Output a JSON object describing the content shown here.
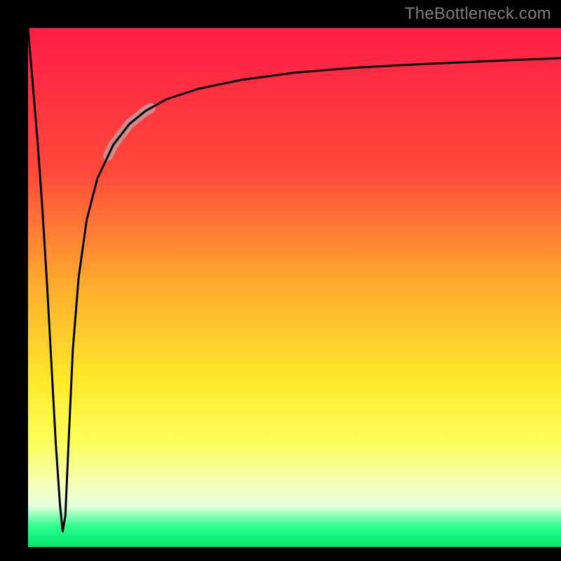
{
  "watermark": "TheBottleneck.com",
  "chart_data": {
    "type": "line",
    "title": "",
    "xlabel": "",
    "ylabel": "",
    "xlim": [
      0,
      100
    ],
    "ylim": [
      0,
      100
    ],
    "gradient_stops": [
      {
        "offset": 0,
        "color": "#ff1c46"
      },
      {
        "offset": 28,
        "color": "#ff4a3a"
      },
      {
        "offset": 50,
        "color": "#ffae2e"
      },
      {
        "offset": 68,
        "color": "#ffe92a"
      },
      {
        "offset": 80,
        "color": "#fbff5a"
      },
      {
        "offset": 88,
        "color": "#f3ffb8"
      },
      {
        "offset": 92,
        "color": "#e7ffdf"
      },
      {
        "offset": 96,
        "color": "#2dff8e"
      },
      {
        "offset": 100,
        "color": "#00e56c"
      }
    ],
    "series": [
      {
        "name": "bottleneck-curve",
        "x": [
          0.0,
          0.9,
          1.8,
          2.7,
          3.6,
          4.4,
          5.2,
          6.0,
          6.5,
          7.0,
          7.6,
          8.4,
          9.5,
          11.0,
          13.0,
          16.0,
          19.0,
          22.0,
          26.0,
          32.0,
          40.0,
          50.0,
          62.0,
          75.0,
          88.0,
          100.0
        ],
        "y": [
          100.0,
          89.0,
          78.0,
          65.0,
          50.0,
          35.0,
          20.0,
          8.0,
          3.0,
          6.0,
          20.0,
          38.0,
          52.0,
          63.0,
          71.0,
          77.5,
          81.5,
          84.0,
          86.3,
          88.3,
          90.0,
          91.4,
          92.4,
          93.1,
          93.7,
          94.2
        ]
      }
    ],
    "highlight_segment": {
      "series": "bottleneck-curve",
      "x_start": 15.0,
      "x_end": 23.0,
      "color": "#c49b9b",
      "width": 14
    }
  }
}
